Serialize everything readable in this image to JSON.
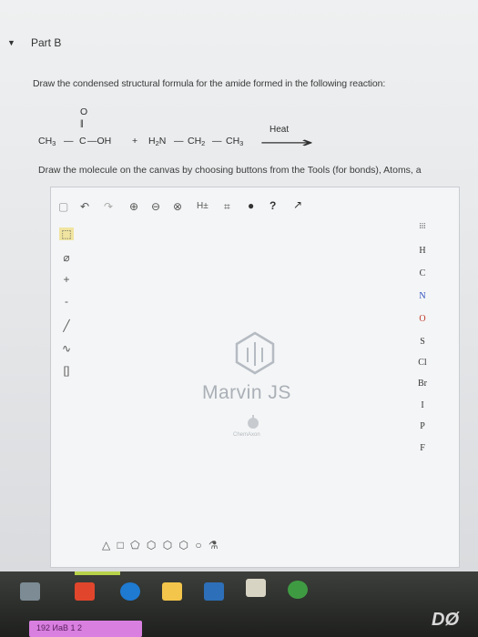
{
  "part": {
    "arrow": "▼",
    "label": "Part B"
  },
  "instruction": "Draw the condensed structural formula for the amide formed in the following reaction:",
  "reaction": {
    "carbonyl_o": "O",
    "double_bond": "||",
    "r1_ch": "CH",
    "r1_sub": "3",
    "bond": "—",
    "c": "C",
    "oh": "—OH",
    "plus": "+",
    "h2n_h": "H",
    "h2n_sub": "2",
    "h2n_n": "N",
    "ch2_ch": "CH",
    "ch2_sub": "2",
    "ch3_ch": "CH",
    "ch3_sub": "3",
    "heat": "Heat",
    "arrow": "⟶"
  },
  "canvas_instruction": "Draw the molecule on the canvas by choosing buttons from the Tools (for bonds), Atoms, a",
  "toolbar": {
    "icons": [
      "▢",
      "↶",
      "↷",
      "⊕",
      "⊖",
      "⊗",
      "H±",
      "⌗",
      "●",
      "?",
      "↗"
    ]
  },
  "left_tools": [
    "⬚",
    "⌀",
    "+",
    "-",
    "╱",
    "∿",
    "[]"
  ],
  "elements": [
    "H",
    "C",
    "N",
    "O",
    "S",
    "Cl",
    "Br",
    "I",
    "P",
    "F"
  ],
  "periodic_icon": "⁞⁞⁞",
  "marvin": {
    "name": "Marvin JS",
    "vendor": "ChemAxon"
  },
  "shapes": "△ □ ⬠ ⬡ ⬡ ⬡ ○ ⚗",
  "taskbar": {
    "label": "192 ИаВ 1 2",
    "logo": "DØ"
  },
  "colors": {
    "accent_green": "#b8d24a",
    "pink": "#d97fe0",
    "element_red": "#c0392b",
    "element_blue": "#2b4fc0"
  }
}
